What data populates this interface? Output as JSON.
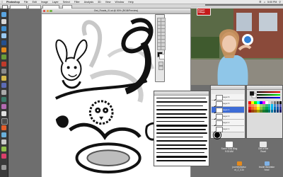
{
  "menubar": {
    "app_name": "Photoshop",
    "items": [
      "File",
      "Edit",
      "Image",
      "Layer",
      "Select",
      "Filter",
      "Analysis",
      "3D",
      "View",
      "Window",
      "Help"
    ],
    "clock": "5:00 PM",
    "apple_icon": "apple-icon"
  },
  "document": {
    "title": "Owl_Roads_01.ai @ 50% (RGB/Preview)"
  },
  "video": {
    "badge_line1": "Expert",
    "badge_line2": "Village"
  },
  "layers": {
    "rows": [
      "Layer 6",
      "Layer 5",
      "Layer 4",
      "Layer 3",
      "Layer 2",
      "Layer 1"
    ]
  },
  "desktop": {
    "item1_label": "Some Kids Blog",
    "item1_sub": "9:30 AM",
    "item2_label": "Owl of the",
    "item2_sub": "Road",
    "item3_label": "journey/episo",
    "item3_sub": "ut_2_3.AI",
    "item4_label": "Inside Illustrator",
    "item4_sub": "hxsd"
  },
  "colors": {
    "menubar": "#e9e9e9",
    "dock": "#3a3a3a",
    "video_sky": "#6b7a55",
    "shirt": "#8fc6e8",
    "accent_red": "#c41a1a",
    "selection": "#3d6cd6"
  }
}
